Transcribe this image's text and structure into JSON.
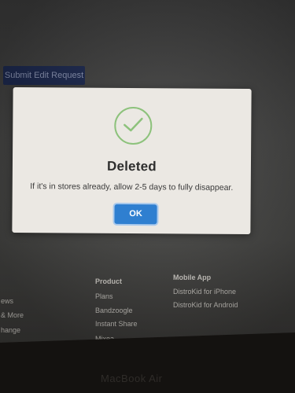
{
  "edit_request": {
    "submit_label": "Submit Edit Request"
  },
  "dialog": {
    "title": "Deleted",
    "message": "If it's in stores already, allow 2-5 days to fully disappear.",
    "ok_label": "OK",
    "icon": "checkmark-circle-icon",
    "accent_color": "#8dc27c",
    "button_color": "#2f7fd0"
  },
  "footer": {
    "left_column": [
      "ews",
      "& More",
      "hange"
    ],
    "product": {
      "heading": "Product",
      "items": [
        "Plans",
        "Bandzoogle",
        "Instant Share",
        "Mixea"
      ]
    },
    "mobile_app": {
      "heading": "Mobile App",
      "items": [
        "DistroKid for iPhone",
        "DistroKid for Android"
      ]
    }
  },
  "device": {
    "label": "MacBook Air"
  }
}
